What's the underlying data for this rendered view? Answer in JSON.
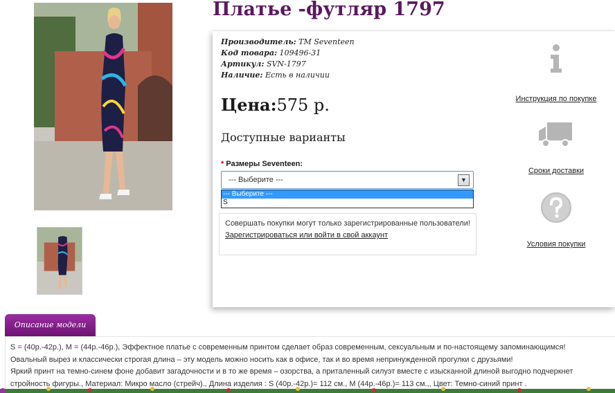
{
  "product": {
    "title": "Платье -футляр 1797",
    "meta": [
      {
        "key": "Производитель:",
        "value": "TM Seventeen"
      },
      {
        "key": "Код товара:",
        "value": "109496-31"
      },
      {
        "key": "Артикул:",
        "value": "SVN-1797"
      },
      {
        "key": "Наличие:",
        "value": "Есть в наличии"
      }
    ],
    "price_label": "Цена:",
    "price_value": "575 р.",
    "variants_title": "Доступные варианты",
    "size_required_mark": "*",
    "size_label": "Размеры Seventeen:",
    "size_select": {
      "selected": "--- Выберите ---",
      "arrow": "▼",
      "options": [
        "--- Выберите ---",
        "S"
      ]
    },
    "notice": {
      "text": "Совершать покупки могут только зарегистрированные пользователи!",
      "link": "Зарегистрироваться или войти в свой аккаунт"
    }
  },
  "info_links": [
    {
      "icon": "info-icon",
      "label": "Инструкция по покупке"
    },
    {
      "icon": "truck-icon",
      "label": "Сроки доставки"
    },
    {
      "icon": "question-icon",
      "label": "Условия покупки"
    }
  ],
  "description": {
    "tab_label": "Описание модели",
    "lines": [
      "S = (40р.-42р.), M = (44р.-46р.), Эффектное платье с современным принтом сделает образ современным, сексуальным и по-настоящему запоминающимся!",
      "Овальный вырез и классически строгая длина – эту модель можно носить как в офисе, так и во время непринужденной прогулки с друзьями!",
      "Яркий принт на темно-синем фоне добавит загадочности и в то же время – озорства, а приталенный силуэт вместе с изысканной длиной выгодно подчеркнет",
      "стройность фигуры., Материал: Микро масло (стрейч)., Длина изделия : S (40р.-42р.)= 112 см., M (44р.-46р.)= 113 см.,, Цвет: Темно-синий принт ."
    ]
  },
  "colors": {
    "title": "#5b1a5f",
    "tab": "#8a2491",
    "select_highlight": "#3399ff"
  }
}
